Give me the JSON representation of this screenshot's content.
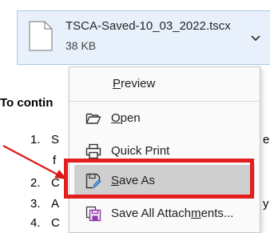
{
  "document": {
    "intro_text": "To contin",
    "list": [
      {
        "num": "1.",
        "text": "S"
      },
      {
        "num": "",
        "text": "f"
      },
      {
        "num": "2.",
        "text": "C"
      },
      {
        "num": "3.",
        "text": "A"
      },
      {
        "num": "4.",
        "text": "C"
      }
    ],
    "right_fragments": [
      "e",
      "",
      "y"
    ]
  },
  "attachment": {
    "filename": "TSCA-Saved-10_03_2022.tscx",
    "size": "38 KB"
  },
  "menu": {
    "items": [
      {
        "label": "Preview",
        "mnemonic": "P",
        "rest": "review",
        "icon": "none"
      },
      {
        "label": "Open",
        "mnemonic": "O",
        "rest": "pen",
        "icon": "folder-open-icon"
      },
      {
        "label": "Quick Print",
        "mnemonic": "",
        "rest": "Quick Print",
        "icon": "printer-icon"
      },
      {
        "label": "Save As",
        "mnemonic": "S",
        "rest": "ave As",
        "icon": "save-as-icon",
        "highlighted": true
      },
      {
        "label": "Save All Attachments...",
        "pre": "Save All Attach",
        "mnemonic": "m",
        "rest": "ents...",
        "icon": "save-all-attachments-icon"
      }
    ]
  },
  "colors": {
    "highlight_border": "#e31e1e",
    "attachment_bg": "#e8f1fb",
    "arrow": "#d81b1b"
  }
}
